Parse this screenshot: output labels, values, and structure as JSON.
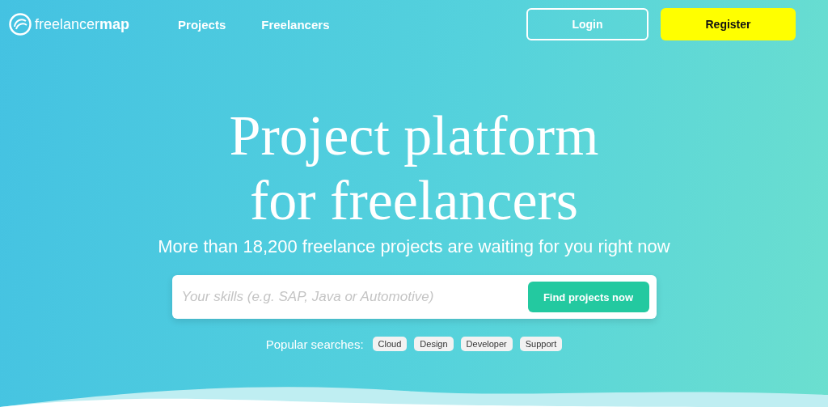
{
  "header": {
    "logo": "freelancer**map**",
    "nav": [
      {
        "label": "Projects"
      },
      {
        "label": "Freelancers"
      }
    ],
    "login": "Login",
    "register": "Register"
  },
  "hero": {
    "title_lines": [
      "Project platform",
      "for freelancers"
    ],
    "subtitle": "More than 18,200 freelance projects are waiting for you right now",
    "search": {
      "placeholder": "Your skills (e.g. SAP, Java or Automotive)",
      "button": "Find projects now"
    },
    "popular": {
      "label": "Popular searches:",
      "tags": [
        "Cloud",
        "Design",
        "Developer",
        "Support"
      ]
    }
  }
}
